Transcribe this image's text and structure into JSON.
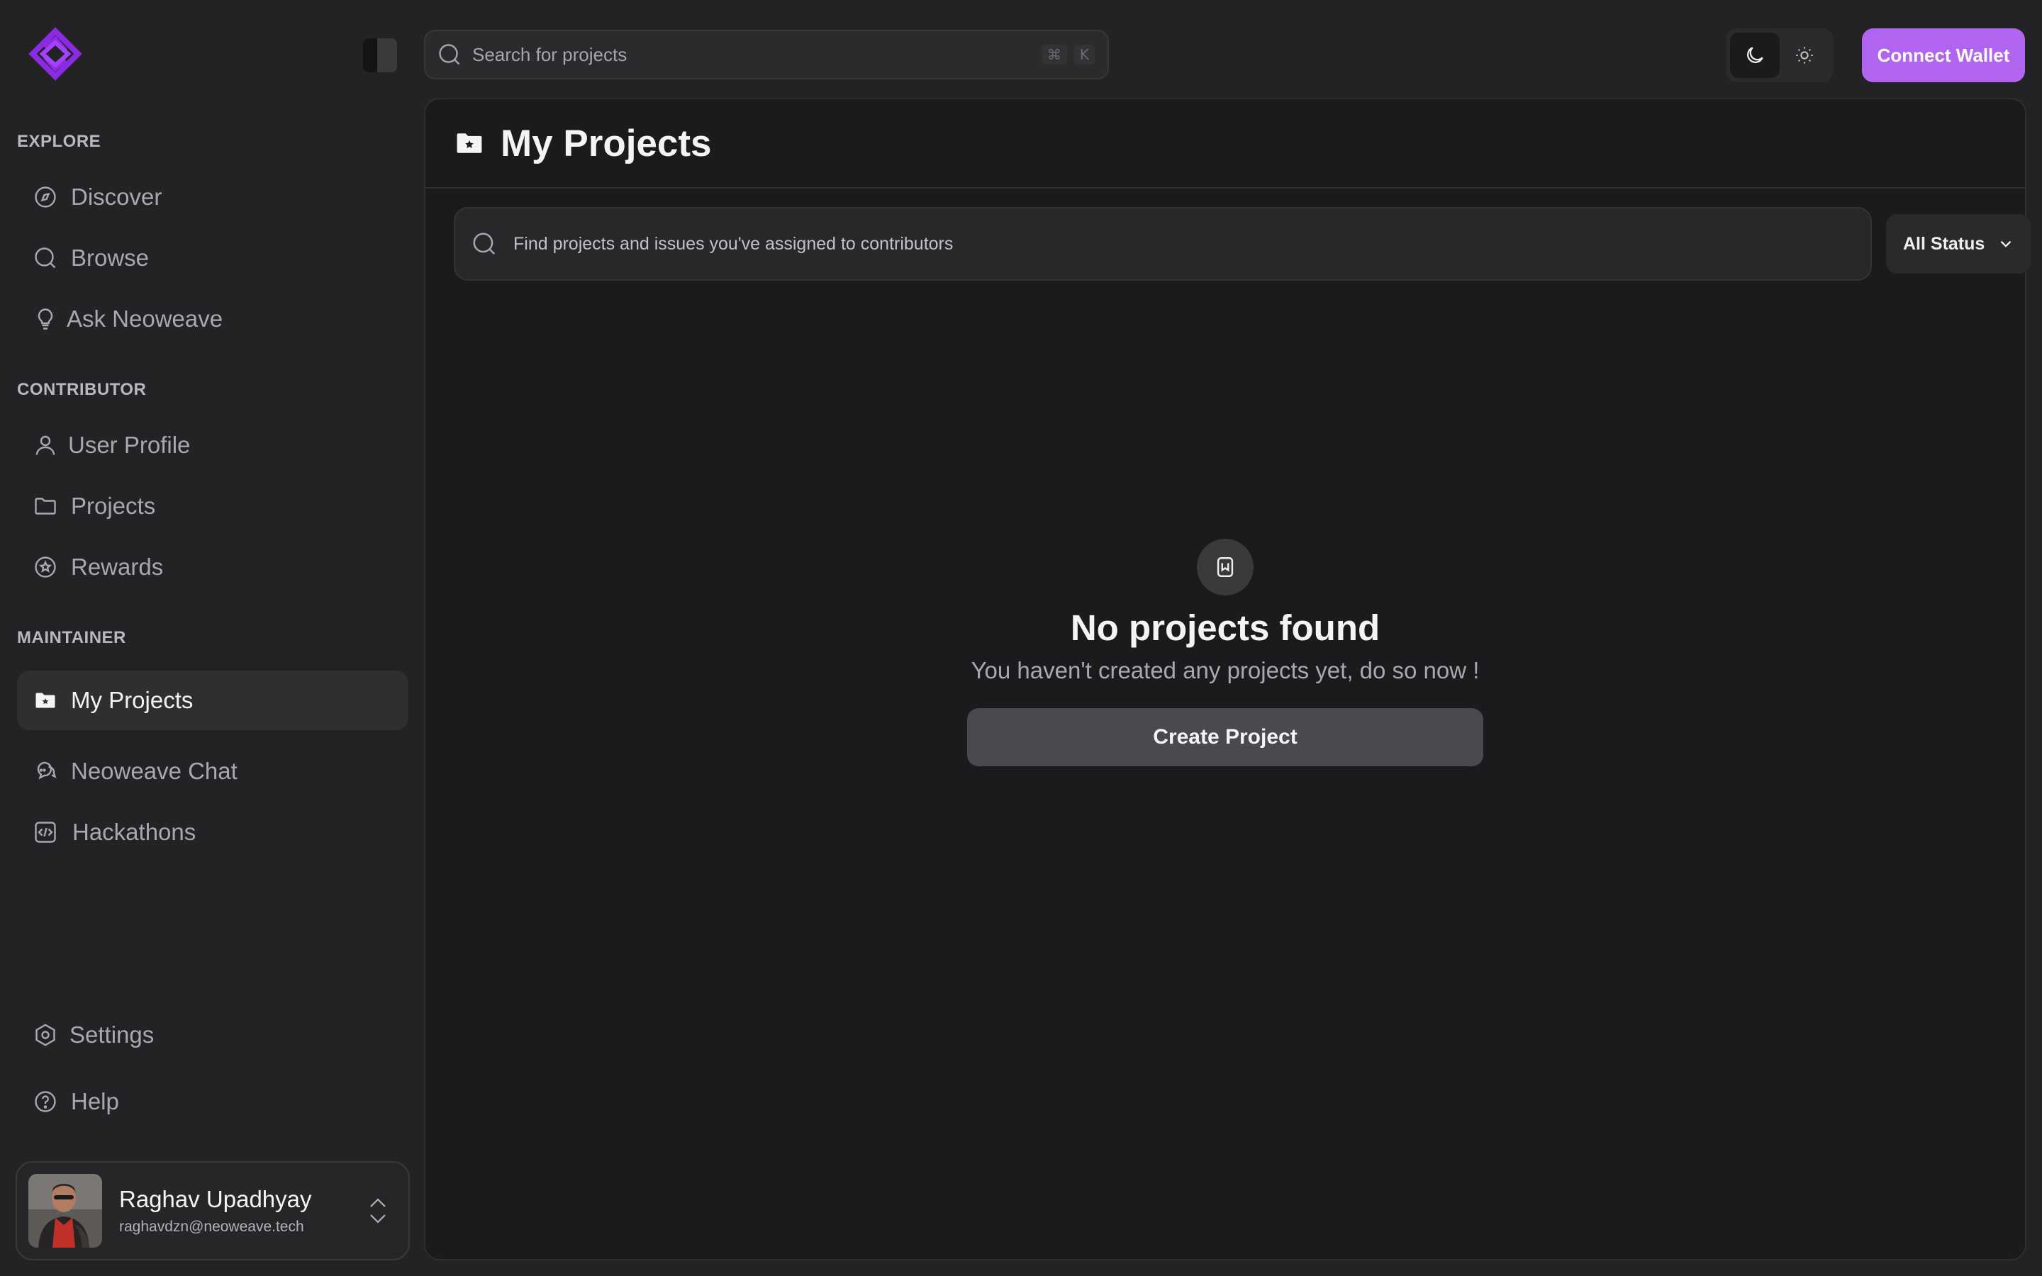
{
  "sidebar": {
    "sections": {
      "explore": "EXPLORE",
      "contributor": "CONTRIBUTOR",
      "maintainer": "MAINTAINER"
    },
    "items": {
      "discover": "Discover",
      "browse": "Browse",
      "ask": "Ask Neoweave",
      "user_profile": "User Profile",
      "projects": "Projects",
      "rewards": "Rewards",
      "my_projects": "My Projects",
      "chat": "Neoweave Chat",
      "hackathons": "Hackathons",
      "settings": "Settings",
      "help": "Help"
    },
    "active_item": "My Projects",
    "user": {
      "name": "Raghav Upadhyay",
      "email": "raghavdzn@neoweave.tech"
    }
  },
  "topbar": {
    "search_placeholder": "Search for projects",
    "shortcut_keys": [
      "⌘",
      "K"
    ],
    "connect_label": "Connect Wallet",
    "theme": "dark"
  },
  "main": {
    "title": "My Projects",
    "find_placeholder": "Find projects and issues you've assigned to contributors",
    "status_filter": "All Status",
    "empty": {
      "title": "No projects found",
      "subtitle": "You haven't created any projects yet, do so now !",
      "button": "Create Project"
    }
  },
  "colors": {
    "accent": "#b064f0",
    "logo": "#8a2be2",
    "background": "#232325",
    "panel": "#1b1b1d"
  }
}
